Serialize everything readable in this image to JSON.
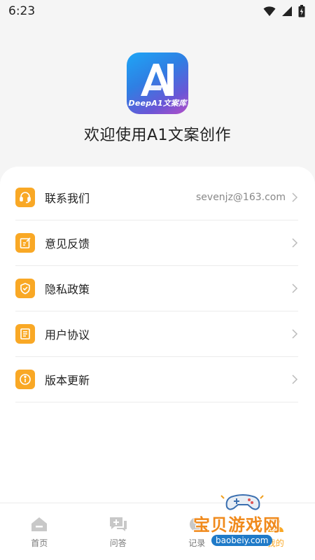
{
  "status_bar": {
    "time": "6:23"
  },
  "header": {
    "logo_text": "DeepA1文案库",
    "welcome": "欢迎使用A1文案创作"
  },
  "menu": {
    "items": [
      {
        "label": "联系我们",
        "value": "sevenjz@163.com",
        "icon": "headset-icon"
      },
      {
        "label": "意见反馈",
        "value": "",
        "icon": "edit-note-icon"
      },
      {
        "label": "隐私政策",
        "value": "",
        "icon": "shield-check-icon"
      },
      {
        "label": "用户协议",
        "value": "",
        "icon": "document-icon"
      },
      {
        "label": "版本更新",
        "value": "",
        "icon": "info-icon"
      }
    ]
  },
  "tabs": [
    {
      "label": "首页",
      "icon": "home-icon"
    },
    {
      "label": "问答",
      "icon": "chat-icon"
    },
    {
      "label": "记录",
      "icon": "record-icon"
    },
    {
      "label": "我的",
      "icon": "profile-icon",
      "active": true
    }
  ],
  "watermark": {
    "title": "宝贝游戏网",
    "url": "baobeiy.com"
  },
  "colors": {
    "accent": "#f9a825",
    "text": "#222222",
    "muted": "#888888",
    "background": "#f5f5f5"
  }
}
